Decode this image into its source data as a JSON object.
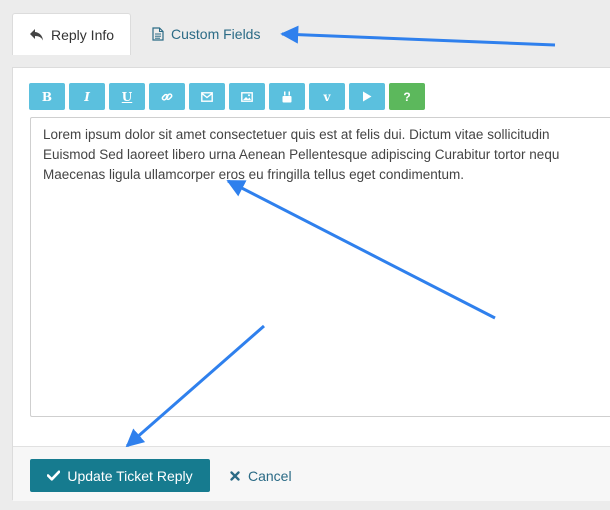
{
  "tabs": {
    "reply_info": "Reply Info",
    "custom_fields": "Custom Fields"
  },
  "toolbar": {
    "buttons": [
      {
        "label": "B",
        "icon": "bold-icon"
      },
      {
        "label": "I",
        "icon": "italic-icon"
      },
      {
        "label": "U",
        "icon": "underline-icon"
      },
      {
        "label": "",
        "icon": "link-icon"
      },
      {
        "label": "",
        "icon": "email-icon"
      },
      {
        "label": "",
        "icon": "image-icon"
      },
      {
        "label": "",
        "icon": "youtube-icon"
      },
      {
        "label": "v",
        "icon": "vimeo-icon"
      },
      {
        "label": "",
        "icon": "play-icon"
      },
      {
        "label": "?",
        "icon": "help-icon"
      }
    ]
  },
  "editor": {
    "value": "Lorem ipsum dolor sit amet consectetuer quis est at felis dui. Dictum vitae sollicitudin\nEuismod Sed laoreet libero urna Aenean Pellentesque adipiscing Curabitur tortor nequ\nMaecenas ligula ullamcorper eros eu fringilla tellus eget condimentum."
  },
  "actions": {
    "submit_label": "Update Ticket Reply",
    "cancel_label": "Cancel"
  },
  "colors": {
    "toolbar_button": "#5bc0de",
    "help_button": "#5cb85c",
    "submit_button": "#167b8f",
    "link": "#2b6b86",
    "annotation_arrow": "#2f80ed"
  }
}
